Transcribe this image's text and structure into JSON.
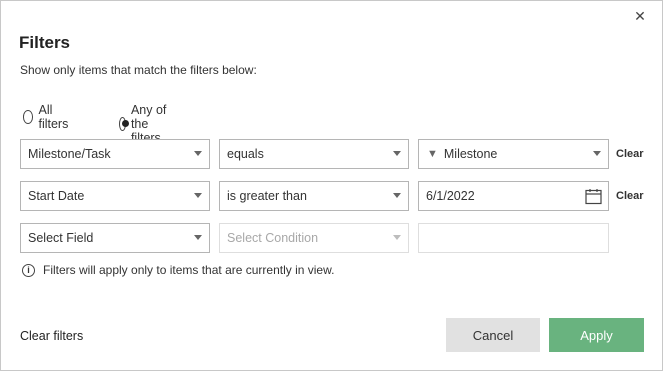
{
  "dialog": {
    "close_glyph": "✕",
    "title": "Filters",
    "subtitle": "Show only items that match the filters below:"
  },
  "match_mode": {
    "options": [
      {
        "label": "All filters",
        "selected": false
      },
      {
        "label": "Any of the filters",
        "selected": true
      }
    ]
  },
  "rows": [
    {
      "field": "Milestone/Task",
      "condition": "equals",
      "value": "Milestone",
      "value_icon": "funnel-icon",
      "clear_label": "Clear"
    },
    {
      "field": "Start Date",
      "condition": "is greater than",
      "value": "6/1/2022",
      "value_icon": "calendar-icon",
      "clear_label": "Clear"
    },
    {
      "field": "Select Field",
      "condition": "Select Condition",
      "value": ""
    }
  ],
  "info_text": "Filters will apply only to items that are currently in view.",
  "footer": {
    "clear_filters_label": "Clear filters",
    "cancel_label": "Cancel",
    "apply_label": "Apply"
  },
  "colors": {
    "apply_button": "#69b37f",
    "cancel_button": "#e1e1e1"
  }
}
